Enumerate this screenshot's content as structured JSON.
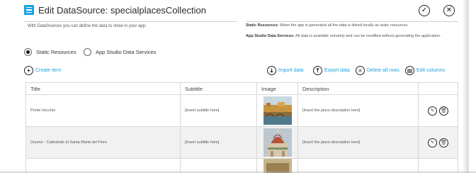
{
  "header": {
    "title": "Edit DataSource: specialplacesCollection",
    "accent_color": "#1ba1e2",
    "icon": "menu-list-icon",
    "ok_icon": "checkmark-icon",
    "close_icon": "close-icon"
  },
  "intro": "With DataSources you can define the data to show in your app.",
  "info": {
    "static_label": "Static Resources:",
    "static_text": " When the app is generated all the data is linked locally as static resources.",
    "services_label": "App Studio Data Services:",
    "services_text": " All data is available remotely and can be modified without generating the application."
  },
  "source_options": [
    {
      "label": "Static Resources",
      "selected": true
    },
    {
      "label": "App Studio Data Services",
      "selected": false
    }
  ],
  "actions": {
    "create": "Create item",
    "import": "Import data",
    "export": "Export data",
    "delete_all": "Delete all rows",
    "edit_columns": "Edit columns"
  },
  "table": {
    "columns": [
      "Title",
      "Subtitle",
      "Image",
      "Description"
    ],
    "rows": [
      {
        "title": "Ponte Vecchio",
        "subtitle": "[Insert subtitle here]",
        "image": "ponte-vecchio-photo",
        "description": "[Insert the place description here]"
      },
      {
        "title": "Duomo - Cattedrale di Santa Maria del Fiore",
        "subtitle": "[Insert subtitle here]",
        "image": "duomo-photo",
        "description": "[Insert the place description here]"
      }
    ],
    "row_actions": [
      "edit-icon",
      "delete-icon"
    ]
  }
}
